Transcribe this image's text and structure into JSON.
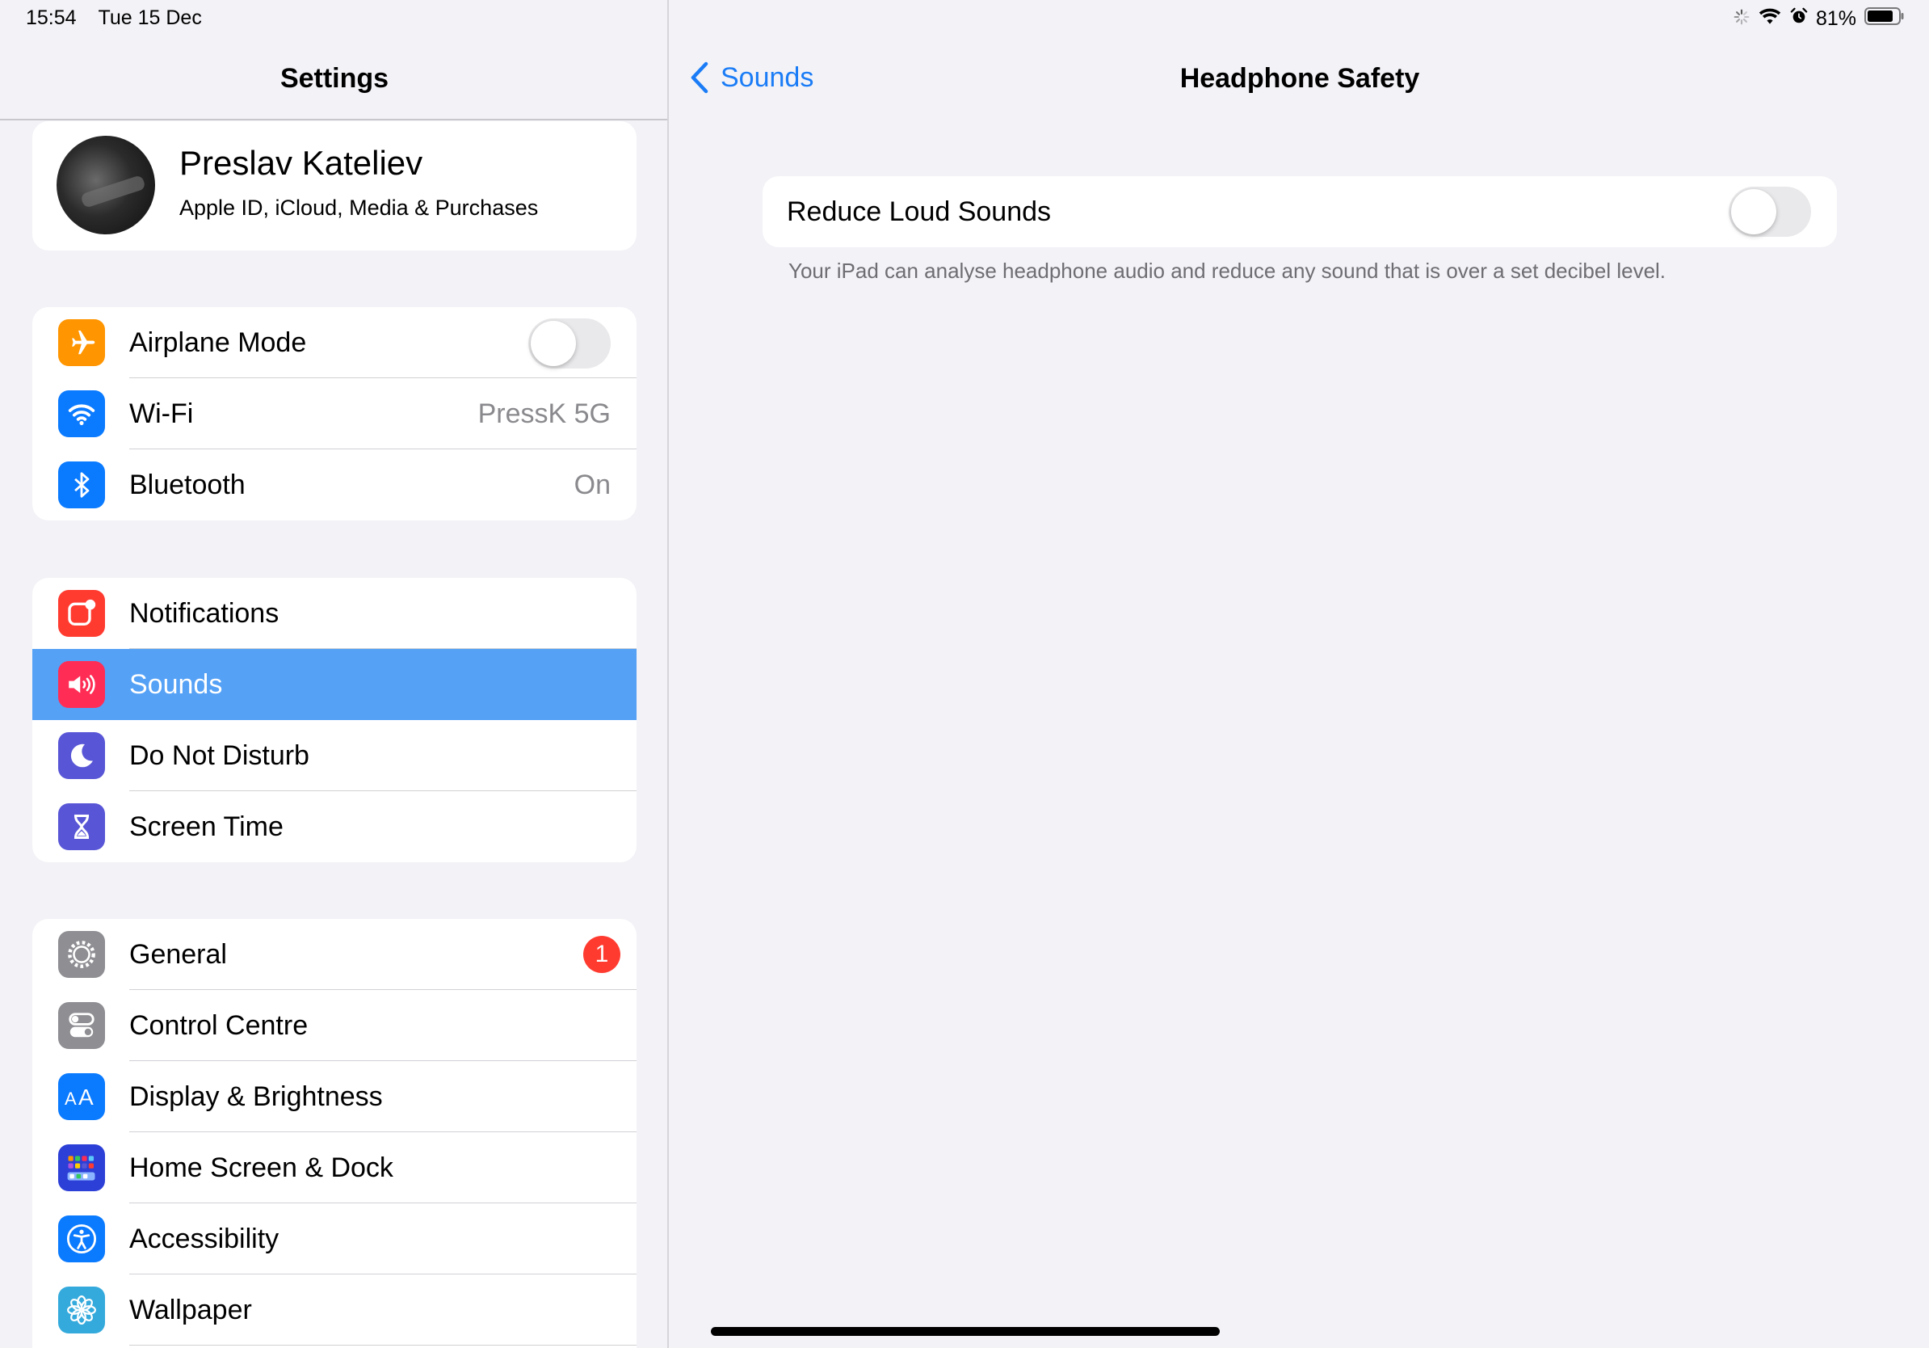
{
  "status_bar": {
    "time": "15:54",
    "date": "Tue 15 Dec",
    "battery": "81%"
  },
  "sidebar": {
    "title": "Settings",
    "profile": {
      "name": "Preslav Kateliev",
      "subtitle": "Apple ID, iCloud, Media & Purchases"
    },
    "connectivity": [
      {
        "label": "Airplane Mode",
        "toggle_on": false,
        "icon": "airplane-icon",
        "color": "#ff9500"
      },
      {
        "label": "Wi-Fi",
        "value": "PressK 5G",
        "icon": "wifi-icon",
        "color": "#0a7aff"
      },
      {
        "label": "Bluetooth",
        "value": "On",
        "icon": "bluetooth-icon",
        "color": "#0a7aff"
      }
    ],
    "alerts": [
      {
        "label": "Notifications",
        "icon": "notifications-icon",
        "color": "#ff3b30"
      },
      {
        "label": "Sounds",
        "icon": "speaker-icon",
        "color": "#ff2d55",
        "selected": true
      },
      {
        "label": "Do Not Disturb",
        "icon": "moon-icon",
        "color": "#5856d6"
      },
      {
        "label": "Screen Time",
        "icon": "hourglass-icon",
        "color": "#5856d6"
      }
    ],
    "system": [
      {
        "label": "General",
        "badge": "1",
        "icon": "gear-icon",
        "color": "#8e8e93"
      },
      {
        "label": "Control Centre",
        "icon": "switches-icon",
        "color": "#8e8e93"
      },
      {
        "label": "Display & Brightness",
        "icon": "aa-text-icon",
        "color": "#0a7aff"
      },
      {
        "label": "Home Screen & Dock",
        "icon": "app-grid-icon",
        "color": "#2c3fd6"
      },
      {
        "label": "Accessibility",
        "icon": "accessibility-icon",
        "color": "#0a7aff"
      },
      {
        "label": "Wallpaper",
        "icon": "flower-icon",
        "color": "#34aadc"
      }
    ]
  },
  "detail": {
    "back_label": "Sounds",
    "title": "Headphone Safety",
    "setting_label": "Reduce Loud Sounds",
    "setting_on": false,
    "footnote": "Your iPad can analyse headphone audio and reduce any sound that is over a set decibel level."
  }
}
